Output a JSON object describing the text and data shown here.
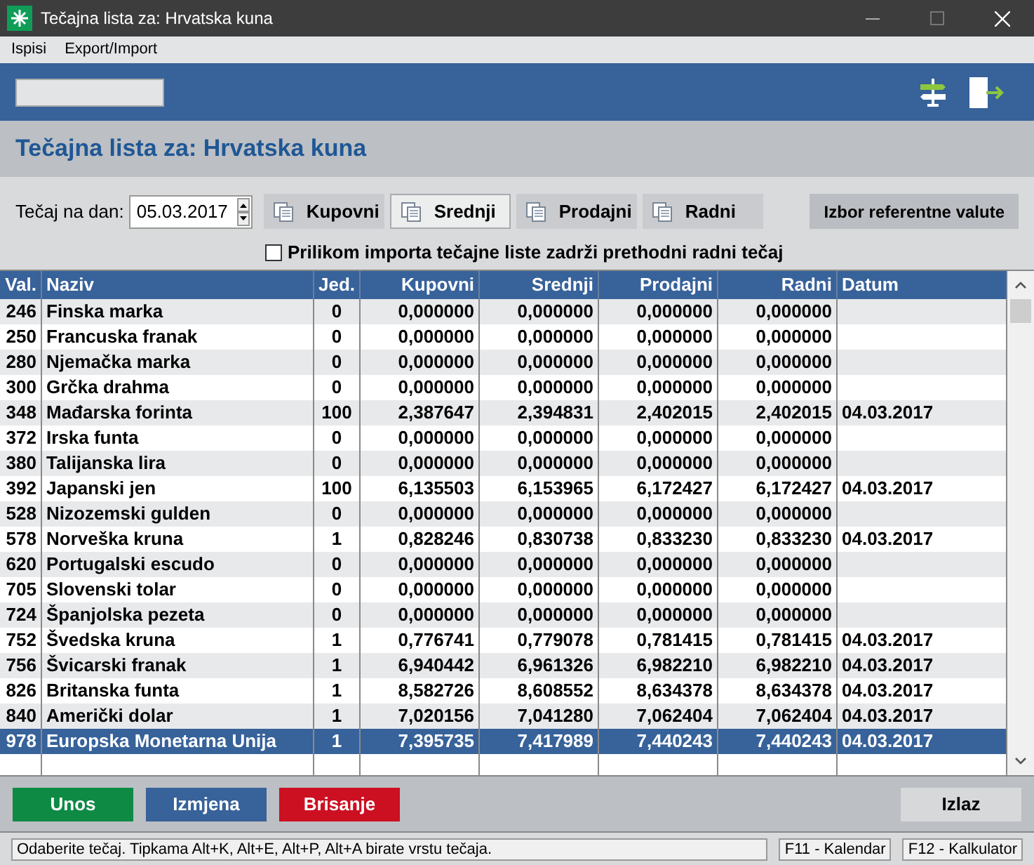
{
  "window": {
    "title": "Tečajna lista za: Hrvatska kuna"
  },
  "menu": [
    "Ispisi",
    "Export/Import"
  ],
  "heading": "Tečajna lista za: Hrvatska kuna",
  "filter": {
    "date_label": "Tečaj na dan:",
    "date_value": "05.03.2017",
    "rate_tabs": [
      {
        "label": "Kupovni",
        "selected": false
      },
      {
        "label": "Srednji",
        "selected": true
      },
      {
        "label": "Prodajni",
        "selected": false
      },
      {
        "label": "Radni",
        "selected": false
      }
    ],
    "reference_button": "Izbor referentne valute",
    "keep_rate": {
      "label": "Prilikom importa tečajne liste zadrži prethodni radni tečaj",
      "checked": false
    }
  },
  "table": {
    "columns": [
      "Val.",
      "Naziv",
      "Jed.",
      "Kupovni",
      "Srednji",
      "Prodajni",
      "Radni",
      "Datum"
    ],
    "rows": [
      {
        "cells": [
          "246",
          "Finska marka",
          "0",
          "0,000000",
          "0,000000",
          "0,000000",
          "0,000000",
          ""
        ],
        "selected": false
      },
      {
        "cells": [
          "250",
          "Francuska franak",
          "0",
          "0,000000",
          "0,000000",
          "0,000000",
          "0,000000",
          ""
        ],
        "selected": false
      },
      {
        "cells": [
          "280",
          "Njemačka marka",
          "0",
          "0,000000",
          "0,000000",
          "0,000000",
          "0,000000",
          ""
        ],
        "selected": false
      },
      {
        "cells": [
          "300",
          "Grčka drahma",
          "0",
          "0,000000",
          "0,000000",
          "0,000000",
          "0,000000",
          ""
        ],
        "selected": false
      },
      {
        "cells": [
          "348",
          "Mađarska forinta",
          "100",
          "2,387647",
          "2,394831",
          "2,402015",
          "2,402015",
          "04.03.2017"
        ],
        "selected": false
      },
      {
        "cells": [
          "372",
          "Irska funta",
          "0",
          "0,000000",
          "0,000000",
          "0,000000",
          "0,000000",
          ""
        ],
        "selected": false
      },
      {
        "cells": [
          "380",
          "Talijanska lira",
          "0",
          "0,000000",
          "0,000000",
          "0,000000",
          "0,000000",
          ""
        ],
        "selected": false
      },
      {
        "cells": [
          "392",
          "Japanski jen",
          "100",
          "6,135503",
          "6,153965",
          "6,172427",
          "6,172427",
          "04.03.2017"
        ],
        "selected": false
      },
      {
        "cells": [
          "528",
          "Nizozemski gulden",
          "0",
          "0,000000",
          "0,000000",
          "0,000000",
          "0,000000",
          ""
        ],
        "selected": false
      },
      {
        "cells": [
          "578",
          "Norveška kruna",
          "1",
          "0,828246",
          "0,830738",
          "0,833230",
          "0,833230",
          "04.03.2017"
        ],
        "selected": false
      },
      {
        "cells": [
          "620",
          "Portugalski escudo",
          "0",
          "0,000000",
          "0,000000",
          "0,000000",
          "0,000000",
          ""
        ],
        "selected": false
      },
      {
        "cells": [
          "705",
          "Slovenski tolar",
          "0",
          "0,000000",
          "0,000000",
          "0,000000",
          "0,000000",
          ""
        ],
        "selected": false
      },
      {
        "cells": [
          "724",
          "Španjolska pezeta",
          "0",
          "0,000000",
          "0,000000",
          "0,000000",
          "0,000000",
          ""
        ],
        "selected": false
      },
      {
        "cells": [
          "752",
          "Švedska kruna",
          "1",
          "0,776741",
          "0,779078",
          "0,781415",
          "0,781415",
          "04.03.2017"
        ],
        "selected": false
      },
      {
        "cells": [
          "756",
          "Švicarski franak",
          "1",
          "6,940442",
          "6,961326",
          "6,982210",
          "6,982210",
          "04.03.2017"
        ],
        "selected": false
      },
      {
        "cells": [
          "826",
          "Britanska funta",
          "1",
          "8,582726",
          "8,608552",
          "8,634378",
          "8,634378",
          "04.03.2017"
        ],
        "selected": false
      },
      {
        "cells": [
          "840",
          "Američki dolar",
          "1",
          "7,020156",
          "7,041280",
          "7,062404",
          "7,062404",
          "04.03.2017"
        ],
        "selected": false
      },
      {
        "cells": [
          "978",
          "Europska Monetarna Unija",
          "1",
          "7,395735",
          "7,417989",
          "7,440243",
          "7,440243",
          "04.03.2017"
        ],
        "selected": true
      }
    ]
  },
  "actions": [
    {
      "label": "Unos",
      "kind": "add"
    },
    {
      "label": "Izmjena",
      "kind": "edit"
    },
    {
      "label": "Brisanje",
      "kind": "delete"
    }
  ],
  "exit_button": "Izlaz",
  "status_bar": [
    "Odaberite tečaj. Tipkama Alt+K, Alt+E, Alt+P, Alt+A birate vrstu tečaja.",
    "F11 - Kalendar",
    "F12 - Kalkulator"
  ]
}
